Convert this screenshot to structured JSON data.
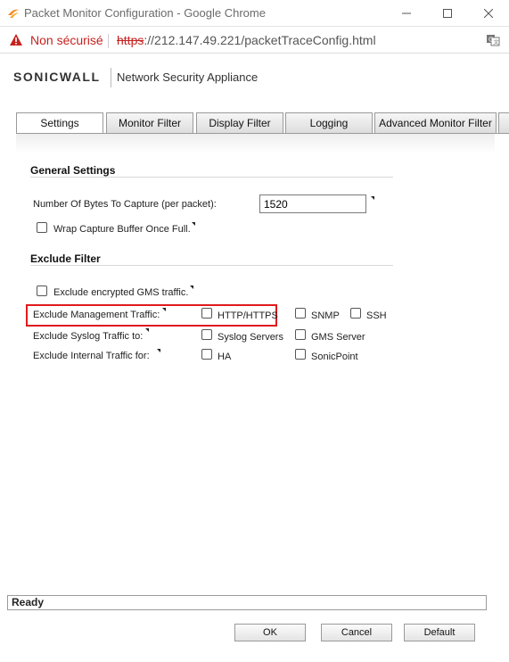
{
  "window": {
    "title": "Packet Monitor Configuration - Google Chrome"
  },
  "address_bar": {
    "security_label": "Non sécurisé",
    "url_scheme": "https",
    "url_rest": "://212.147.49.221/packetTraceConfig.html"
  },
  "brand": {
    "logo_text": "SONICWALL",
    "product_name": "Network Security Appliance"
  },
  "tabs": [
    {
      "label": "Settings",
      "active": true
    },
    {
      "label": "Monitor Filter",
      "active": false
    },
    {
      "label": "Display Filter",
      "active": false
    },
    {
      "label": "Logging",
      "active": false
    },
    {
      "label": "Advanced Monitor Filter",
      "active": false
    }
  ],
  "general_settings": {
    "heading": "General Settings",
    "bytes_label": "Number Of Bytes To Capture (per packet):",
    "bytes_value": "1520",
    "wrap_label": "Wrap Capture Buffer Once Full.",
    "wrap_checked": false
  },
  "exclude_filter": {
    "heading": "Exclude Filter",
    "encrypted_gms_label": "Exclude encrypted GMS traffic.",
    "mgmt_label": "Exclude Management Traffic:",
    "mgmt_options": [
      "HTTP/HTTPS",
      "SNMP",
      "SSH"
    ],
    "syslog_label": "Exclude Syslog Traffic to:",
    "syslog_options": [
      "Syslog Servers",
      "GMS Server"
    ],
    "internal_label": "Exclude Internal Traffic for:",
    "internal_options": [
      "HA",
      "SonicPoint"
    ]
  },
  "status": {
    "text": "Ready"
  },
  "buttons": {
    "ok": "OK",
    "cancel": "Cancel",
    "default": "Default"
  },
  "colors": {
    "highlight_box": "#e01b1b",
    "insecure": "#c5221f"
  }
}
